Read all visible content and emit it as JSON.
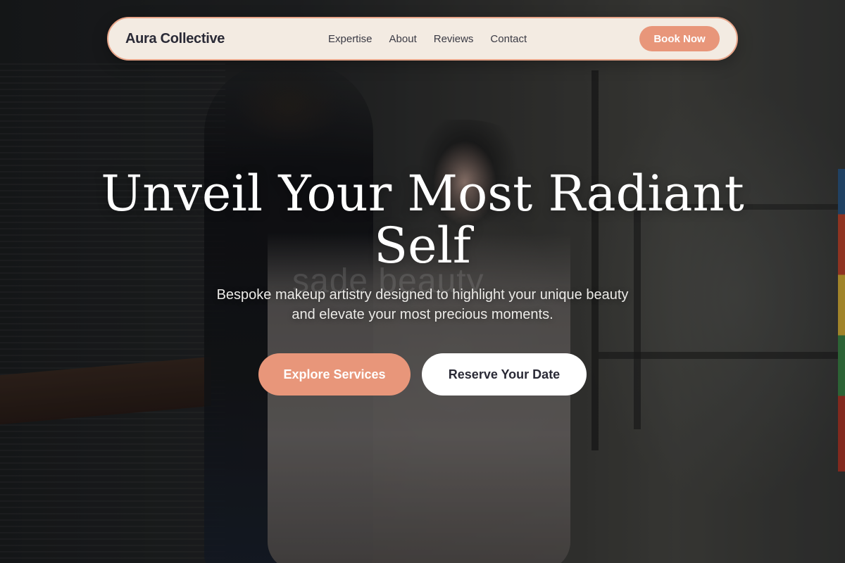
{
  "nav": {
    "brand": "Aura Collective",
    "links": [
      "Expertise",
      "About",
      "Reviews",
      "Contact"
    ],
    "book_label": "Book Now"
  },
  "hero": {
    "headline": "Unveil Your Most Radiant Self",
    "subtitle_line1": "Bespoke makeup artistry designed to highlight your unique beauty",
    "subtitle_line2": "and elevate your most precious moments.",
    "primary_cta": "Explore Services",
    "secondary_cta": "Reserve Your Date",
    "watermark": "sade beauty"
  },
  "colors": {
    "accent": "#e8967a",
    "nav_background": "#f3ebe2",
    "text_dark": "#2a2a36"
  }
}
